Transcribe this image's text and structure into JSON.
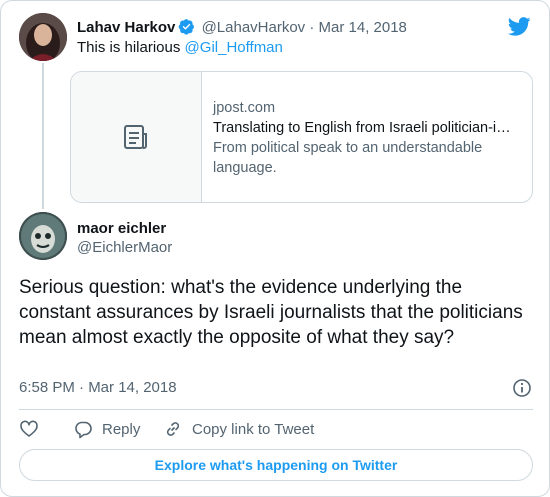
{
  "parent_tweet": {
    "author_name": "Lahav Harkov",
    "handle": "@LahavHarkov",
    "separator": "·",
    "date": "Mar 14, 2018",
    "text_prefix": "This is hilarious ",
    "mention": "@Gil_Hoffman",
    "link_card": {
      "domain": "jpost.com",
      "title": "Translating to English from Israeli politician-i…",
      "description": "From political speak to an understandable language."
    }
  },
  "main_tweet": {
    "author_name": "maor eichler",
    "handle": "@EichlerMaor",
    "text": "Serious question: what's the evidence underlying the constant assurances by Israeli journalists that the politicians mean almost exactly the opposite of what they say?",
    "timestamp": "6:58 PM · Mar 14, 2018"
  },
  "actions": {
    "like_icon": "heart-icon",
    "reply_label": "Reply",
    "copy_link_label": "Copy link to Tweet"
  },
  "explore_label": "Explore what's happening on Twitter",
  "colors": {
    "accent": "#1d9bf0",
    "text": "#0f1419",
    "muted": "#536471",
    "border": "#cfd9de"
  }
}
